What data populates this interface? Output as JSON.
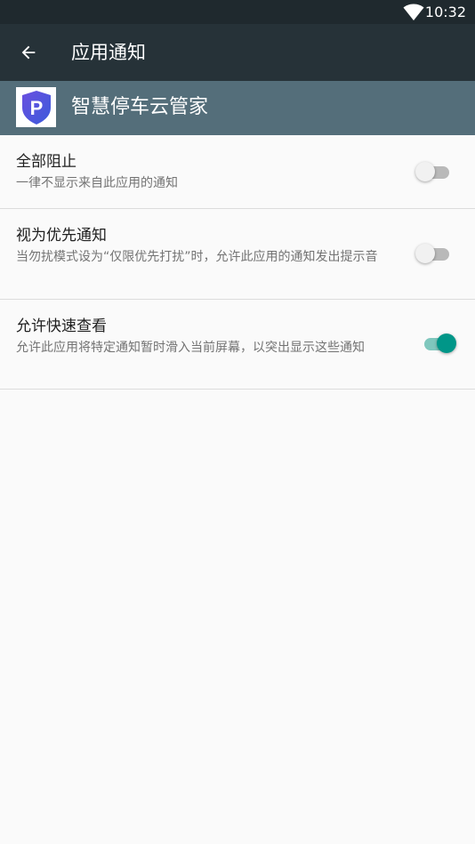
{
  "status_bar": {
    "time": "10:32",
    "wifi_icon": "wifi-icon"
  },
  "app_bar": {
    "back_icon": "arrow-back-icon",
    "title": "应用通知"
  },
  "app_header": {
    "name": "智慧停车云管家",
    "icon": "parking-p-shield-icon",
    "icon_letter": "P"
  },
  "settings": [
    {
      "label": "全部阻止",
      "description": "一律不显示来自此应用的通知",
      "enabled": false
    },
    {
      "label": "视为优先通知",
      "description": "当勿扰模式设为“仅限优先打扰”时，允许此应用的通知发出提示音",
      "enabled": false
    },
    {
      "label": "允许快速查看",
      "description": "允许此应用将特定通知暂时滑入当前屏幕，以突出显示这些通知",
      "enabled": true
    }
  ],
  "colors": {
    "status_bar": "#1f292e",
    "app_bar": "#263238",
    "app_header": "#546e7a",
    "accent": "#009688",
    "background": "#fafafa"
  }
}
